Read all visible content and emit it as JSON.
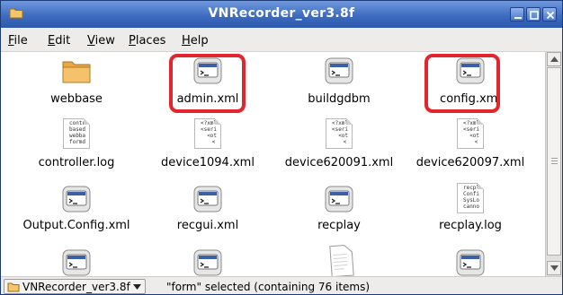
{
  "window": {
    "title": "VNRecorder_ver3.8f"
  },
  "menu": [
    {
      "label": "File",
      "key": "F",
      "rest": "ile"
    },
    {
      "label": "Edit",
      "key": "E",
      "rest": "dit"
    },
    {
      "label": "View",
      "key": "V",
      "rest": "iew"
    },
    {
      "label": "Places",
      "key": "P",
      "rest": "laces"
    },
    {
      "label": "Help",
      "key": "H",
      "rest": "elp"
    }
  ],
  "files": {
    "r0": [
      "webbase",
      "admin.xml",
      "buildgdbm",
      "config.xml"
    ],
    "r1": [
      "controller.log",
      "device1094.xml",
      "device620091.xml",
      "device620097.xml"
    ],
    "r2": [
      "Output.Config.xml",
      "recgui.xml",
      "recplay",
      "recplay.log"
    ]
  },
  "previews": {
    "controller": "contr\nbased\nwebba\nformd",
    "xml": "<?xml\n<seri\n  <ot\n   <",
    "recplay_log": "recpl\nConfi\nSysLo\ncanno"
  },
  "highlighted_files": [
    "admin.xml",
    "config.xml"
  ],
  "status": {
    "location": "VNRecorder_ver3.8f",
    "message": "\"form\" selected (containing 76 items)"
  },
  "icons": {
    "folder": "folder-icon",
    "executable": "executable-icon",
    "text_file": "text-file-icon",
    "blank_doc": "blank-document-icon"
  },
  "colors": {
    "title_bar": "#3e6cc0",
    "highlight": "#e3262d",
    "folder": "#f0b552"
  }
}
